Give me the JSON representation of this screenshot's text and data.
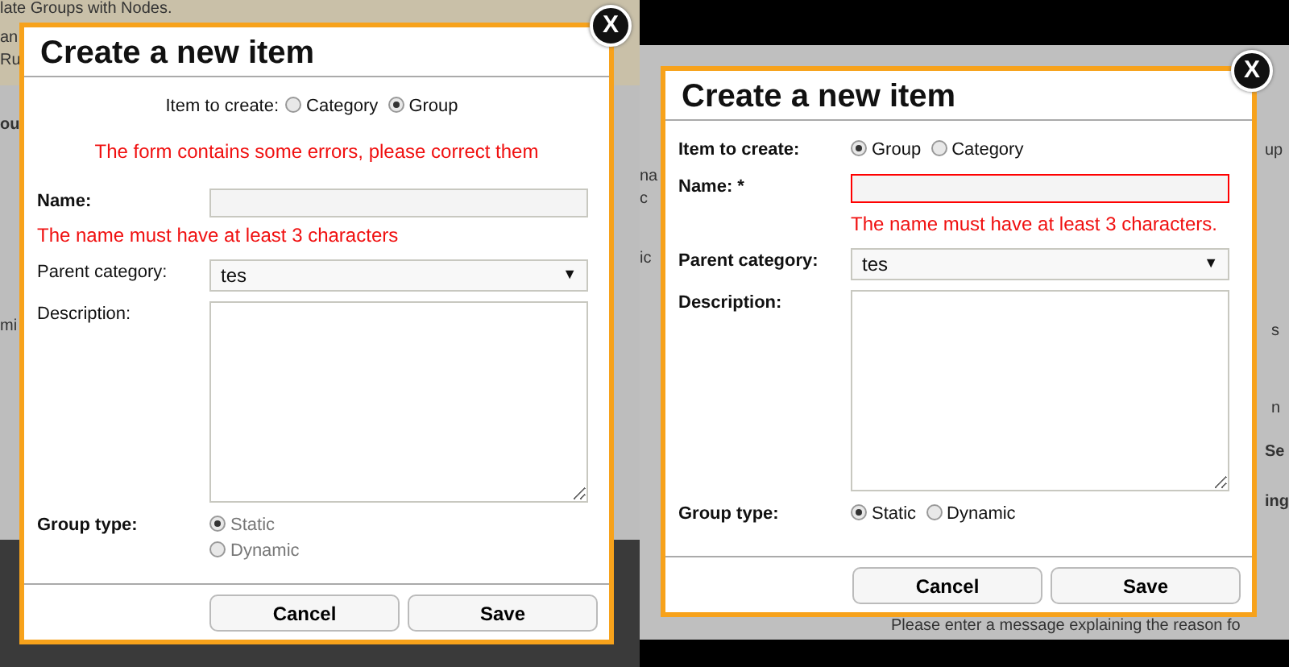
{
  "panels": [
    {
      "background_texts": [
        {
          "text": "late Groups with Nodes.",
          "bold": false
        },
        {
          "text": "an",
          "bold": false
        },
        {
          "text": "Ru",
          "bold": false
        },
        {
          "text": "ou",
          "bold": true
        },
        {
          "text": "mi",
          "bold": false
        }
      ],
      "dialog": {
        "title": "Create a new item",
        "close": "X",
        "rows": [
          {
            "kind": "inline-radio",
            "label": "Item to create:",
            "label_bold": false,
            "options": [
              {
                "label": "Category",
                "selected": false
              },
              {
                "label": "Group",
                "selected": true
              }
            ]
          },
          {
            "kind": "form-error",
            "text": "The form contains some errors, please correct them"
          },
          {
            "kind": "text",
            "label": "Name:",
            "label_bold": true,
            "invalid": false
          },
          {
            "kind": "error",
            "text": "The name must have at least 3 characters"
          },
          {
            "kind": "select",
            "label": "Parent category:",
            "label_bold": false,
            "value": "tes",
            "caret": "▼"
          },
          {
            "kind": "textarea",
            "label": "Description:",
            "label_bold": false
          },
          {
            "kind": "radio-stacked",
            "label": "Group type:",
            "label_bold": true,
            "disabled": true,
            "options": [
              {
                "label": "Static",
                "selected": true
              },
              {
                "label": "Dynamic",
                "selected": false
              }
            ]
          }
        ],
        "buttons": [
          "Cancel",
          "Save"
        ]
      }
    },
    {
      "background_texts": [
        {
          "text": "na",
          "bold": false
        },
        {
          "text": "c",
          "bold": false
        },
        {
          "text": "up",
          "bold": false
        },
        {
          "text": "ic",
          "bold": false
        },
        {
          "text": "s",
          "bold": false
        },
        {
          "text": "n",
          "bold": false
        },
        {
          "text": "Se",
          "bold": true
        },
        {
          "text": "ing",
          "bold": true
        },
        {
          "text": "Please enter a message explaining the reason fo",
          "bold": false
        }
      ],
      "dialog": {
        "title": "Create a new item",
        "close": "X",
        "rows": [
          {
            "kind": "radio",
            "label": "Item to create:",
            "label_bold": true,
            "options": [
              {
                "label": "Group",
                "selected": true
              },
              {
                "label": "Category",
                "selected": false
              }
            ]
          },
          {
            "kind": "text",
            "label": "Name: *",
            "label_bold": true,
            "invalid": true
          },
          {
            "kind": "field-error",
            "text": "The name must have at least 3 characters."
          },
          {
            "kind": "select",
            "label": "Parent category:",
            "label_bold": true,
            "value": "tes",
            "caret": "▼"
          },
          {
            "kind": "textarea",
            "label": "Description:",
            "label_bold": true
          },
          {
            "kind": "radio",
            "label": "Group type:",
            "label_bold": true,
            "disabled": false,
            "options": [
              {
                "label": "Static",
                "selected": true
              },
              {
                "label": "Dynamic",
                "selected": false
              }
            ]
          }
        ],
        "buttons": [
          "Cancel",
          "Save"
        ]
      }
    }
  ]
}
